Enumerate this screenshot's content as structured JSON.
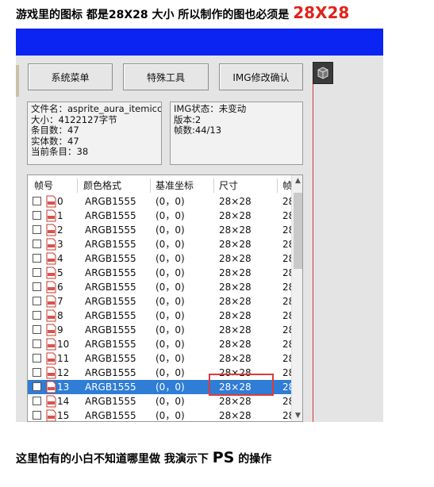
{
  "captions": {
    "top_text": "游戏里的图标 都是28X28 大小 所以制作的图也必须是",
    "top_big": "28X28",
    "bottom_text": "这里怕有的小白不知道哪里做 我演示下",
    "bottom_big": "PS",
    "bottom_tail": " 的操作"
  },
  "toolbar": {
    "system_menu": "系统菜单",
    "special_tools": "特殊工具",
    "img_modify": "IMG修改确认"
  },
  "file_info": {
    "filename": "文件名：asprite_aura_itemicc",
    "size": "大小：4122127字节",
    "entries": "条目数：47",
    "entities": "实体数：47",
    "current": "当前条目：38"
  },
  "img_info": {
    "status": "IMG状态：未变动",
    "version": "版本:2",
    "frames": "帧数:44/13"
  },
  "table": {
    "headers": [
      "帧号",
      "颜色格式",
      "基准坐标",
      "尺寸",
      "帧"
    ],
    "rows": [
      {
        "frame": "0",
        "format": "ARGB1555",
        "coord": "(0，0)",
        "size": "28×28",
        "extra": "28"
      },
      {
        "frame": "1",
        "format": "ARGB1555",
        "coord": "(0，0)",
        "size": "28×28",
        "extra": "28"
      },
      {
        "frame": "2",
        "format": "ARGB1555",
        "coord": "(0，0)",
        "size": "28×28",
        "extra": "28"
      },
      {
        "frame": "3",
        "format": "ARGB1555",
        "coord": "(0，0)",
        "size": "28×28",
        "extra": "28"
      },
      {
        "frame": "4",
        "format": "ARGB1555",
        "coord": "(0，0)",
        "size": "28×28",
        "extra": "28"
      },
      {
        "frame": "5",
        "format": "ARGB1555",
        "coord": "(0，0)",
        "size": "28×28",
        "extra": "28"
      },
      {
        "frame": "6",
        "format": "ARGB1555",
        "coord": "(0，0)",
        "size": "28×28",
        "extra": "28"
      },
      {
        "frame": "7",
        "format": "ARGB1555",
        "coord": "(0，0)",
        "size": "28×28",
        "extra": "28"
      },
      {
        "frame": "8",
        "format": "ARGB1555",
        "coord": "(0，0)",
        "size": "28×28",
        "extra": "28"
      },
      {
        "frame": "9",
        "format": "ARGB1555",
        "coord": "(0，0)",
        "size": "28×28",
        "extra": "28"
      },
      {
        "frame": "10",
        "format": "ARGB1555",
        "coord": "(0，0)",
        "size": "28×28",
        "extra": "28"
      },
      {
        "frame": "11",
        "format": "ARGB1555",
        "coord": "(0，0)",
        "size": "28×28",
        "extra": "28"
      },
      {
        "frame": "12",
        "format": "ARGB1555",
        "coord": "(0，0)",
        "size": "28×28",
        "extra": "28"
      },
      {
        "frame": "13",
        "format": "ARGB1555",
        "coord": "(0，0)",
        "size": "28×28",
        "extra": "28"
      },
      {
        "frame": "14",
        "format": "ARGB1555",
        "coord": "(0，0)",
        "size": "28×28",
        "extra": "28"
      },
      {
        "frame": "15",
        "format": "ARGB1555",
        "coord": "(0，0)",
        "size": "28×28",
        "extra": "28"
      }
    ],
    "selected_index": 13
  },
  "colors": {
    "titlebar": "#0b24f2",
    "highlight_box": "#e03a3a",
    "selection": "#2f7dd6"
  },
  "icons": {
    "cube_button": "cube-icon",
    "row_icon": "image-file-icon"
  }
}
